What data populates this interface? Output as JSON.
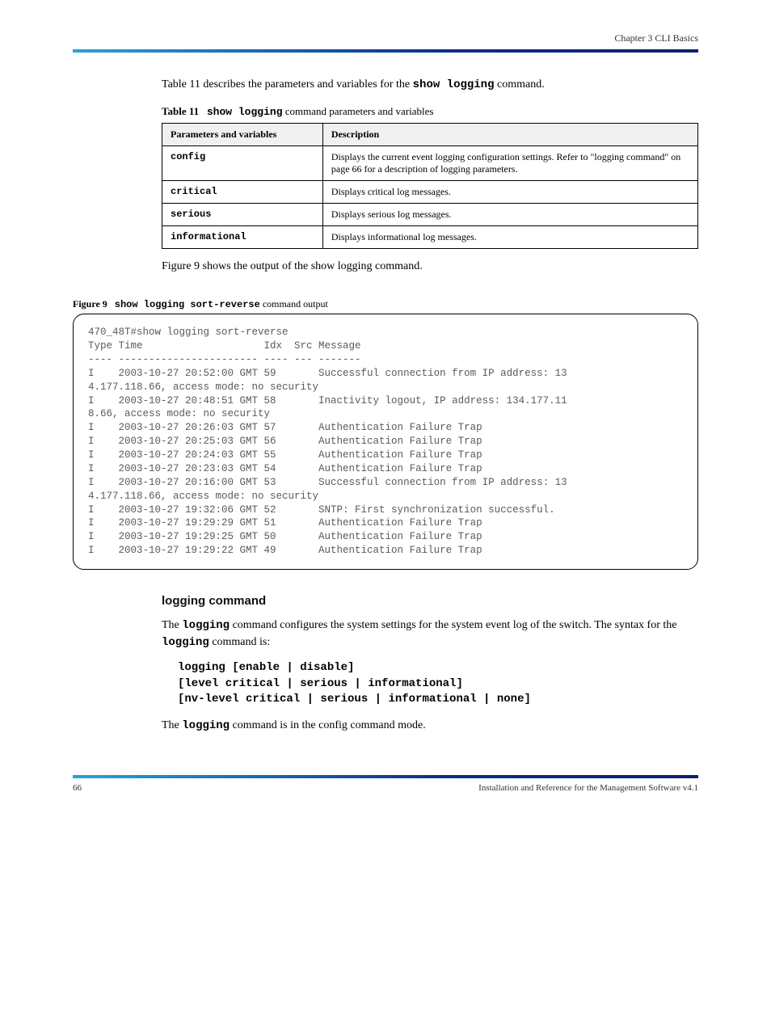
{
  "header": {
    "title": "Chapter 3 CLI Basics"
  },
  "intro": {
    "table_ref_text": "Table 11 describes the parameters and variables for the ",
    "show_logging": "show logging",
    "command_suffix": " command."
  },
  "table": {
    "caption_strong": "Table 11",
    "caption_rest": "show logging",
    "caption_suffix": " command parameters and variables",
    "head_param": "Parameters and variables",
    "head_desc": "Description",
    "rows": [
      {
        "param": "config",
        "desc": "Displays the current event logging configuration settings. Refer to \"logging command\" on page 66 for a description of logging parameters."
      },
      {
        "param": "critical",
        "desc": "Displays critical log messages."
      },
      {
        "param": "serious",
        "desc": "Displays serious log messages."
      },
      {
        "param": "informational",
        "desc": "Displays informational log messages."
      }
    ]
  },
  "figure_intro": "Figure 9 shows the output of the show logging command.",
  "figure": {
    "caption_strong": "Figure 9",
    "caption_rest": "show logging sort-reverse",
    "caption_suffix": " command output"
  },
  "terminal": "470_48T#show logging sort-reverse\nType Time                    Idx  Src Message\n---- ----------------------- ---- --- -------\nI    2003-10-27 20:52:00 GMT 59       Successful connection from IP address: 13\n4.177.118.66, access mode: no security\nI    2003-10-27 20:48:51 GMT 58       Inactivity logout, IP address: 134.177.11\n8.66, access mode: no security\nI    2003-10-27 20:26:03 GMT 57       Authentication Failure Trap\nI    2003-10-27 20:25:03 GMT 56       Authentication Failure Trap\nI    2003-10-27 20:24:03 GMT 55       Authentication Failure Trap\nI    2003-10-27 20:23:03 GMT 54       Authentication Failure Trap\nI    2003-10-27 20:16:00 GMT 53       Successful connection from IP address: 13\n4.177.118.66, access mode: no security\nI    2003-10-27 19:32:06 GMT 52       SNTP: First synchronization successful.\nI    2003-10-27 19:29:29 GMT 51       Authentication Failure Trap\nI    2003-10-27 19:29:25 GMT 50       Authentication Failure Trap\nI    2003-10-27 19:29:22 GMT 49       Authentication Failure Trap",
  "section": {
    "heading": "logging command",
    "p1_a": "The ",
    "p1_cmd": "logging",
    "p1_b": " command configures the system settings for the system event log of the switch. The syntax for the ",
    "p1_cmd2": "logging",
    "p1_c": " command is:",
    "syntax": "logging [enable | disable]\n[level critical | serious | informational]\n[nv-level critical | serious | informational | none]",
    "p2_a": "The ",
    "p2_cmd": "logging",
    "p2_b": " command is in the config command mode."
  },
  "footer": {
    "left": "66",
    "right": "Installation and Reference for the Management Software v4.1"
  }
}
